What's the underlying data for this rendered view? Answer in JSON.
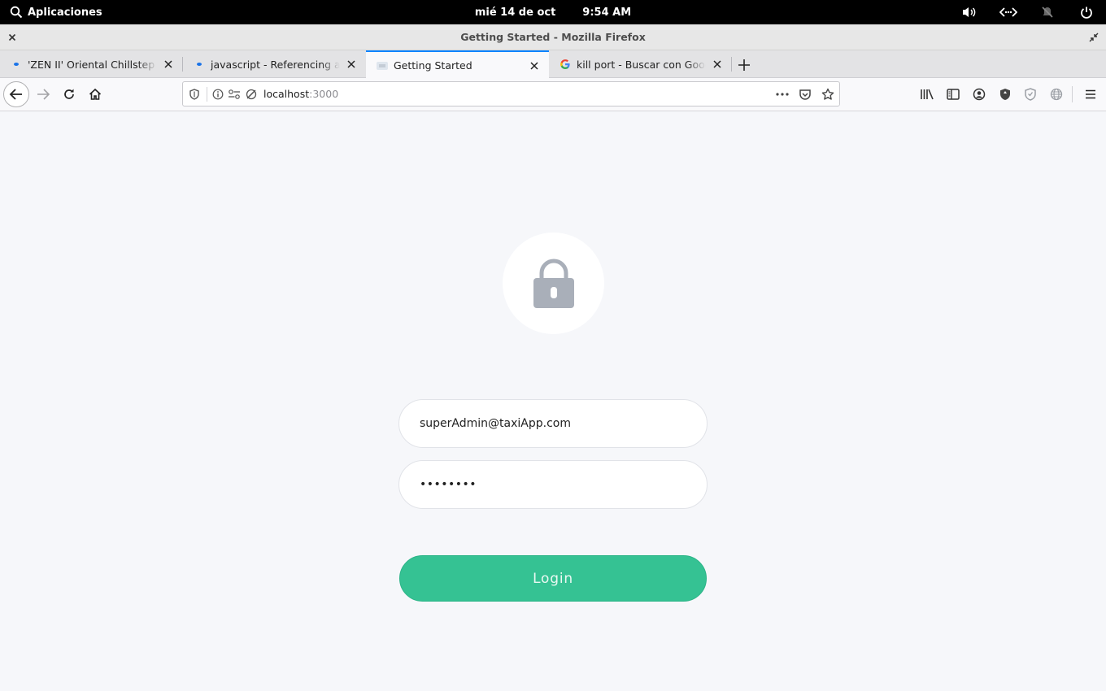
{
  "system_bar": {
    "apps_label": "Aplicaciones",
    "date": "mié 14 de oct",
    "time": "9:54 AM"
  },
  "window": {
    "title": "Getting Started - Mozilla Firefox"
  },
  "tabs": [
    {
      "title": "'ZEN II' Oriental Chillstep Mix",
      "active": false
    },
    {
      "title": "javascript - Referencing another",
      "active": false
    },
    {
      "title": "Getting Started",
      "active": true
    },
    {
      "title": "kill port - Buscar con Google",
      "active": false
    }
  ],
  "urlbar": {
    "host": "localhost",
    "port": ":3000"
  },
  "login_form": {
    "email_value": "superAdmin@taxiApp.com",
    "password_value": "••••••••",
    "login_label": "Login"
  },
  "colors": {
    "accent_tab": "#0a84ff",
    "login_button": "#35c293",
    "lock_icon": "#a9afb9",
    "page_bg": "#f6f7fa"
  }
}
